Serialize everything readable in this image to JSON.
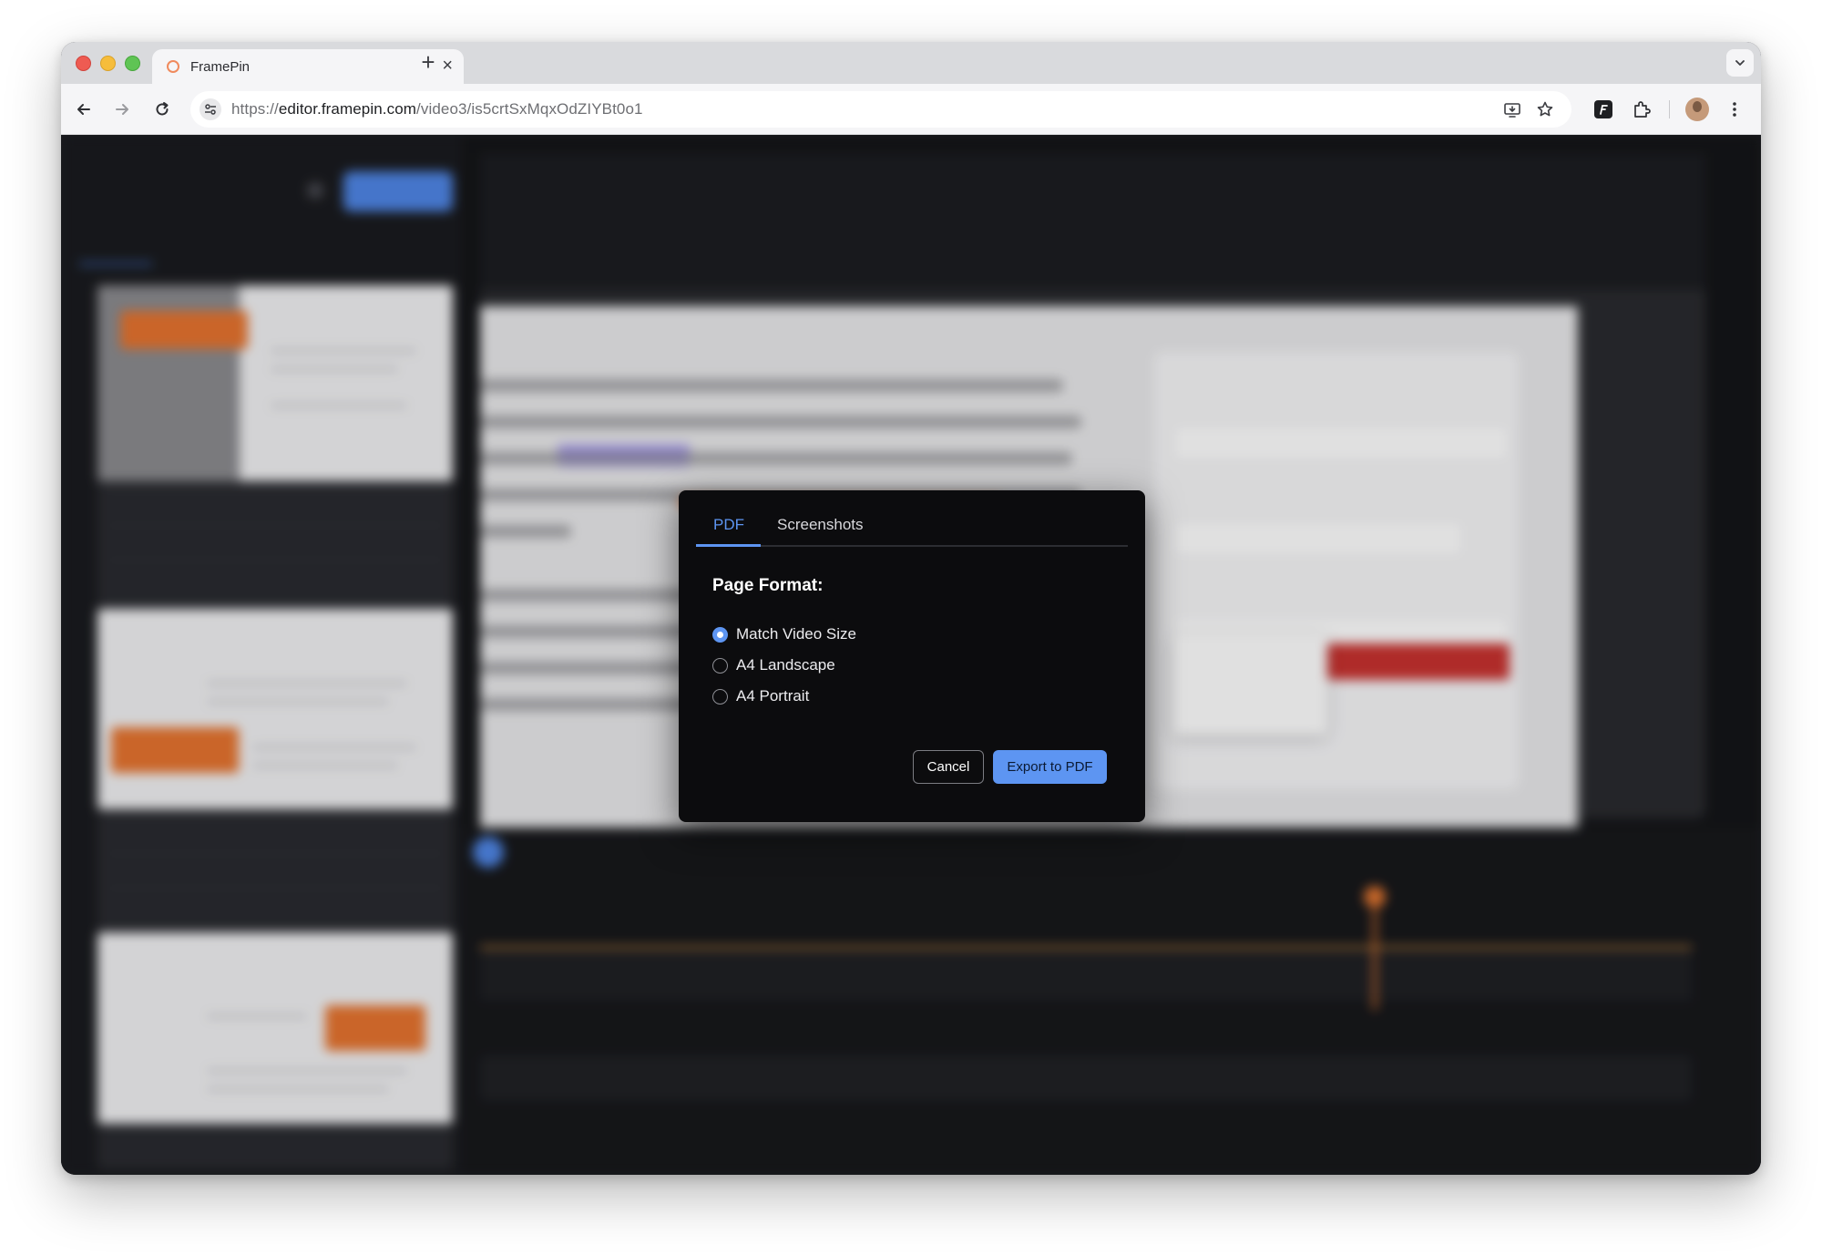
{
  "browser": {
    "tab_title": "FramePin",
    "tab_close": "×",
    "new_tab": "+",
    "url_prefix": "https://",
    "url_host": "editor.framepin.com",
    "url_path": "/video3/is5crtSxMqxOdZIYBt0o1"
  },
  "modal": {
    "tabs": [
      {
        "label": "PDF",
        "active": true
      },
      {
        "label": "Screenshots",
        "active": false
      }
    ],
    "heading": "Page Format:",
    "options": [
      {
        "label": "Match Video Size",
        "checked": true
      },
      {
        "label": "A4 Landscape",
        "checked": false
      },
      {
        "label": "A4 Portrait",
        "checked": false
      }
    ],
    "cancel_label": "Cancel",
    "export_label": "Export to PDF"
  },
  "colors": {
    "accent": "#5d95f2",
    "modal_background": "#0c0c0e",
    "highlight_orange": "#e6742f"
  },
  "icons": [
    "back-arrow-icon",
    "forward-arrow-icon",
    "reload-icon",
    "site-settings-icon",
    "install-app-icon",
    "star-icon",
    "framepin-extension-icon",
    "extensions-puzzle-icon",
    "profile-avatar",
    "more-vert-icon",
    "tab-search-chevron-icon"
  ]
}
